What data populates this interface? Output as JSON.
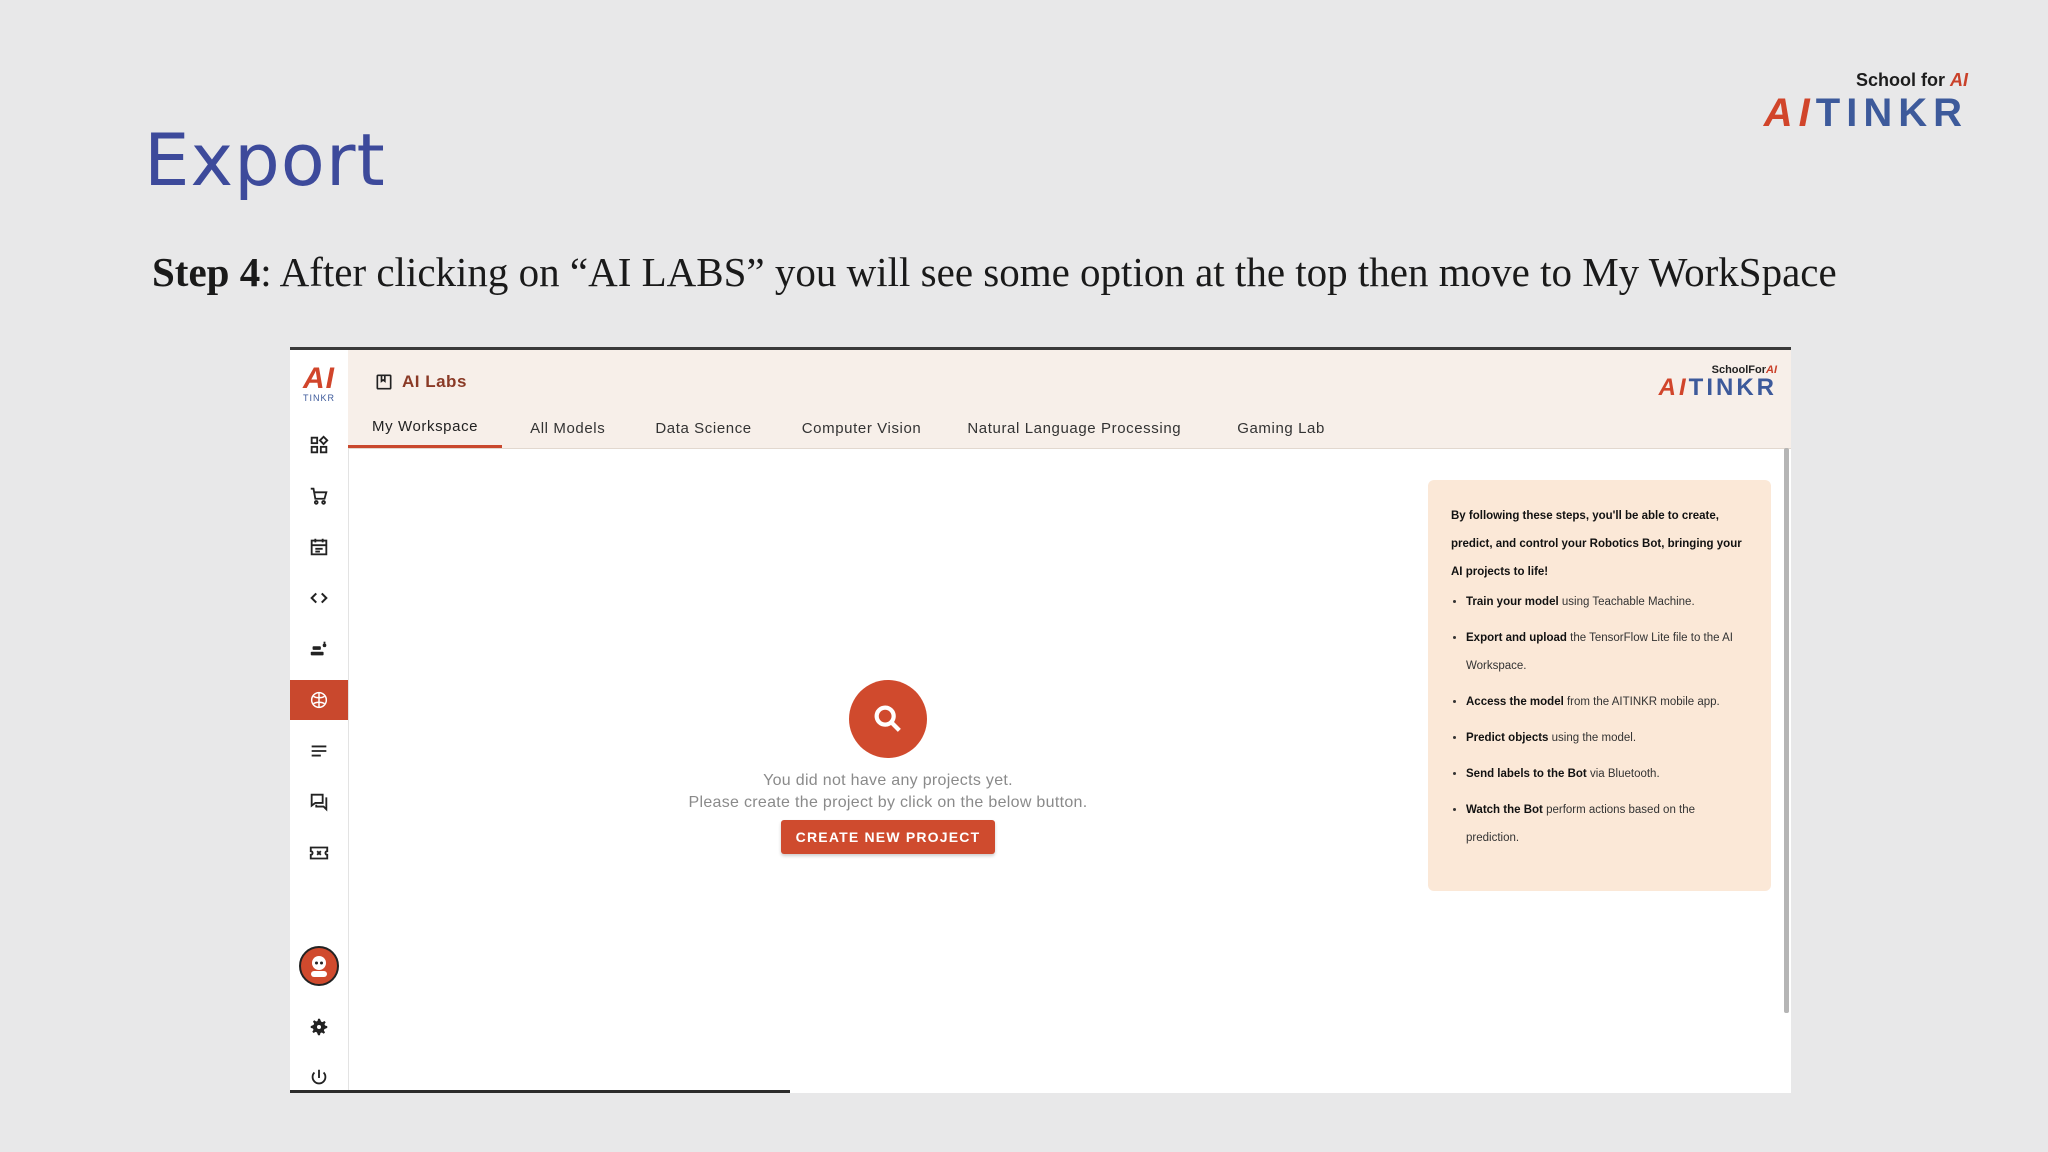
{
  "slide": {
    "title": "Export",
    "step_label": "Step 4",
    "step_text": ":  After clicking on “AI LABS” you will see some option at the top then move to My WorkSpace"
  },
  "brand": {
    "school_text": "School for",
    "school_ai": "AI",
    "logo_a": "AI",
    "logo_b": "TINKR",
    "colors": {
      "red": "#d1452b",
      "blue": "#3d5a9b"
    }
  },
  "app": {
    "sidebar_logo": {
      "big": "AI",
      "small": "TINKR"
    },
    "sidebar_icons": [
      "dashboard-icon",
      "cart-icon",
      "calendar-icon",
      "code-icon",
      "robot-arm-icon",
      "ai-labs-icon",
      "list-icon",
      "forum-icon",
      "ticket-icon",
      "avatar-icon",
      "settings-icon",
      "power-icon"
    ],
    "header": {
      "title": "AI Labs",
      "school_text": "SchoolFor",
      "school_ai": "AI",
      "logo_a": "AI",
      "logo_b": "TINKR"
    },
    "tabs": [
      {
        "label": "My Workspace",
        "active": true
      },
      {
        "label": "All Models",
        "active": false
      },
      {
        "label": "Data Science",
        "active": false
      },
      {
        "label": "Computer Vision",
        "active": false
      },
      {
        "label": "Natural Language Processing",
        "active": false
      },
      {
        "label": "Gaming Lab",
        "active": false
      }
    ],
    "empty": {
      "line1": "You did not have any projects yet.",
      "line2": "Please create the project by click on the below button.",
      "button": "CREATE NEW PROJECT"
    },
    "info": {
      "intro": "By following these steps, you'll be able to create, predict, and control your Robotics Bot, bringing your AI projects to life!",
      "items": [
        {
          "bold": "Train your model",
          "rest": " using Teachable Machine."
        },
        {
          "bold": "Export and upload",
          "rest": " the TensorFlow Lite file to the AI Workspace."
        },
        {
          "bold": "Access the model",
          "rest": " from the AITINKR mobile app."
        },
        {
          "bold": "Predict objects",
          "rest": " using the model."
        },
        {
          "bold": "Send labels to the Bot",
          "rest": " via Bluetooth."
        },
        {
          "bold": "Watch the Bot",
          "rest": " perform actions based on the prediction."
        }
      ]
    }
  }
}
